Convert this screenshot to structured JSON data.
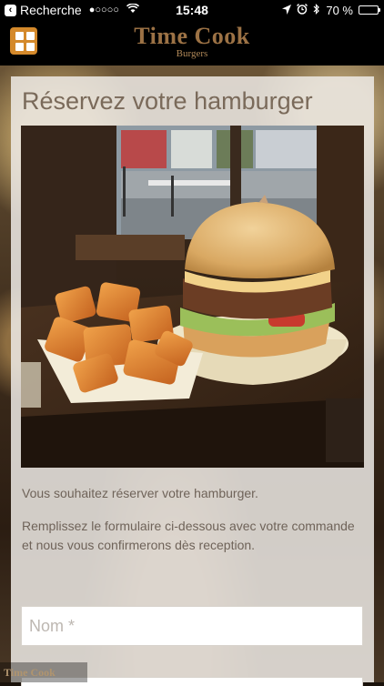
{
  "status_bar": {
    "back_label": "Recherche",
    "time": "15:48",
    "battery_percent": "70 %",
    "battery_level": 0.7,
    "icons": [
      "signal-dots-icon",
      "wifi-icon",
      "location-icon",
      "alarm-icon",
      "bluetooth-icon",
      "battery-icon"
    ]
  },
  "header": {
    "menu_icon": "grid-menu-icon",
    "brand_title": "Time Cook",
    "brand_subtitle": "Burgers",
    "colors": {
      "accent": "#d4892b",
      "brand": "#9c7245"
    }
  },
  "card": {
    "title": "Réservez votre hamburger",
    "photo_subject": "burger-and-fries-photo",
    "intro": "Vous souhaitez réserver votre hamburger.",
    "instructions": "Remplissez le formulaire ci-dessous avec votre commande et nous vous confirmerons dès reception.",
    "name_field": {
      "placeholder": "Nom *",
      "value": ""
    }
  },
  "footer": {
    "brand": "Time Cook"
  }
}
